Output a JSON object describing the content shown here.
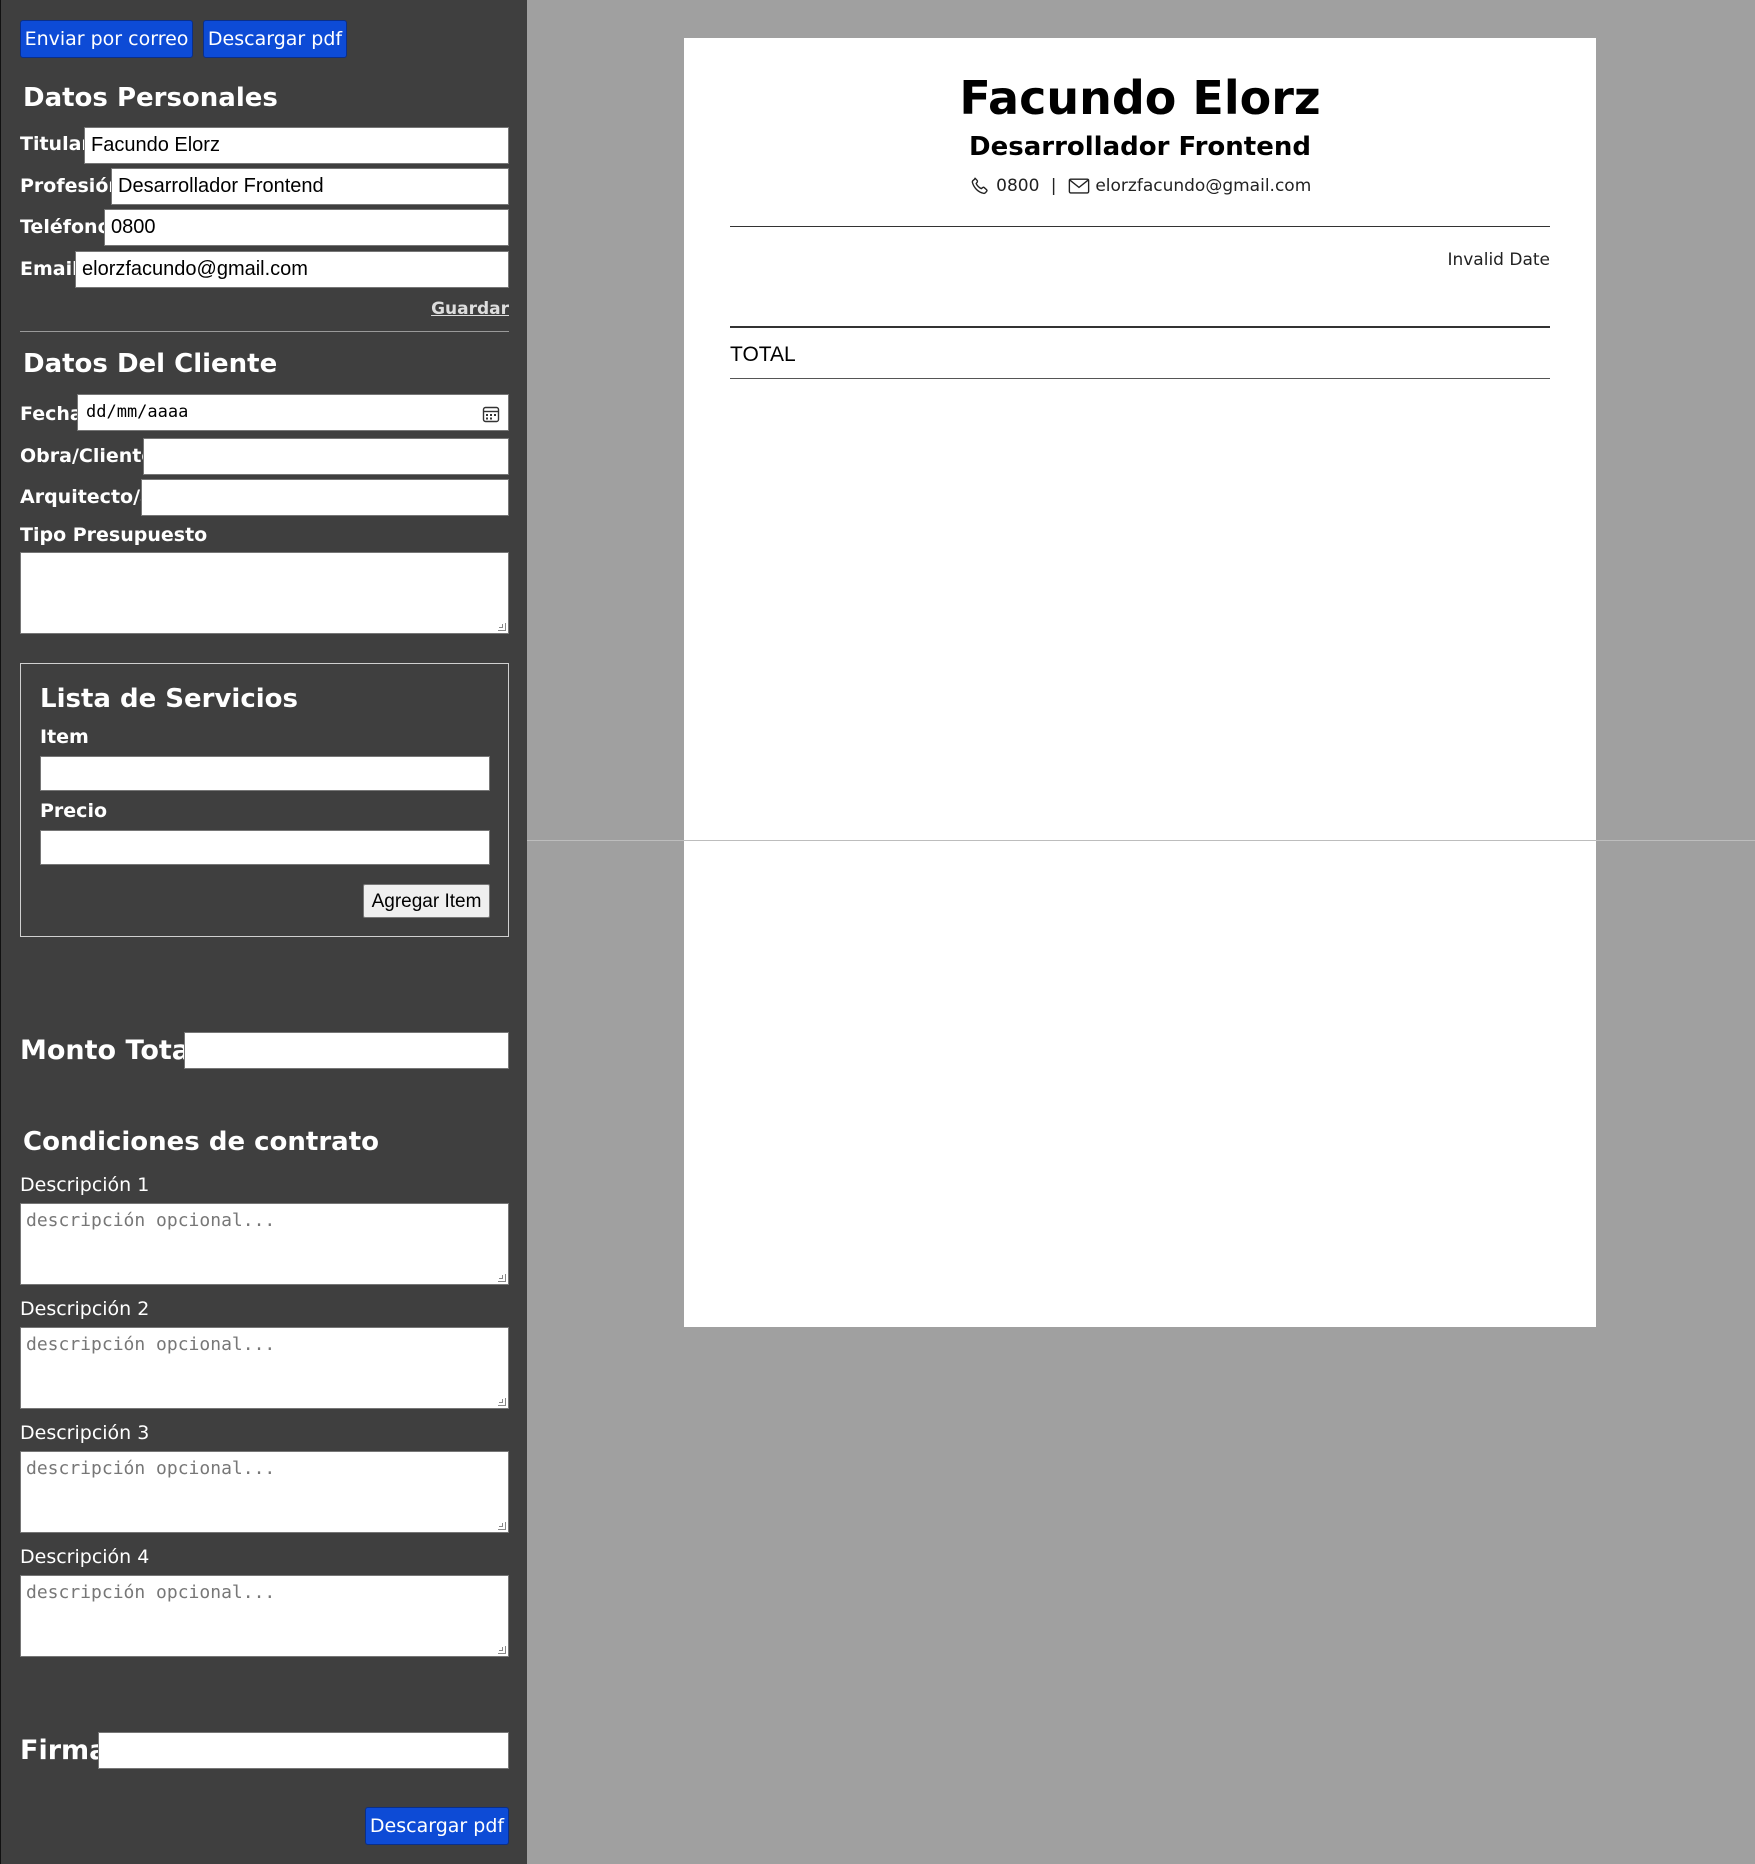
{
  "toolbar": {
    "email_button": "Enviar por correo",
    "pdf_button": "Descargar pdf"
  },
  "personal": {
    "heading": "Datos Personales",
    "titular_label": "Titular",
    "titular_value": "Facundo Elorz",
    "profesion_label": "Profesión",
    "profesion_value": "Desarrollador Frontend",
    "telefono_label": "Teléfono",
    "telefono_value": "0800",
    "email_label": "Email",
    "email_value": "elorzfacundo@gmail.com",
    "save_link": "Guardar"
  },
  "client": {
    "heading": "Datos Del Cliente",
    "fecha_label": "Fecha",
    "fecha_placeholder": "dd/mm/aaaa",
    "obra_label": "Obra/Cliente",
    "obra_value": "",
    "arquitecto_label": "Arquitecto/a",
    "arquitecto_value": "",
    "tipo_label": "Tipo Presupuesto"
  },
  "services": {
    "heading": "Lista de Servicios",
    "item_label": "Item",
    "precio_label": "Precio",
    "add_button": "Agregar Item"
  },
  "total": {
    "label": "Monto Total",
    "value": ""
  },
  "conditions": {
    "heading": "Condiciones de contrato",
    "items": [
      {
        "label": "Descripción 1",
        "placeholder": "descripción opcional..."
      },
      {
        "label": "Descripción 2",
        "placeholder": "descripción opcional..."
      },
      {
        "label": "Descripción 3",
        "placeholder": "descripción opcional..."
      },
      {
        "label": "Descripción 4",
        "placeholder": "descripción opcional..."
      }
    ]
  },
  "firma": {
    "label": "Firma",
    "value": ""
  },
  "bottom": {
    "pdf_button": "Descargar pdf"
  },
  "document": {
    "name": "Facundo Elorz",
    "profession": "Desarrollador Frontend",
    "phone": "0800",
    "separator": "|",
    "email": "elorzfacundo@gmail.com",
    "date": "Invalid Date",
    "total_label": "TOTAL"
  },
  "icons": {
    "phone": "phone-icon",
    "mail": "mail-icon",
    "calendar": "calendar-icon"
  }
}
